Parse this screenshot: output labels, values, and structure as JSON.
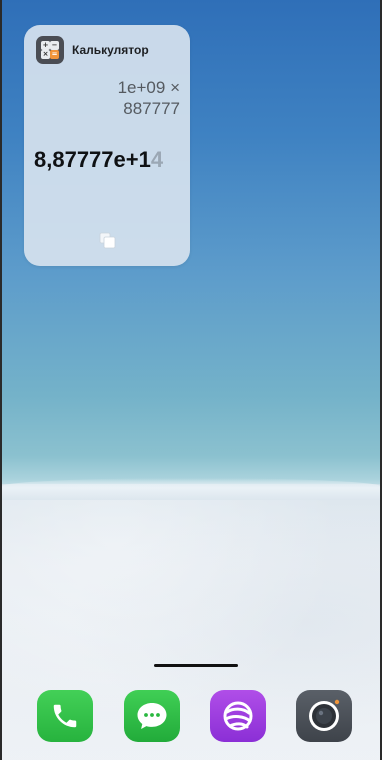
{
  "widget": {
    "app_name": "Калькулятор",
    "expression_line1": "1e+09 ×",
    "expression_line2": "887777",
    "result_main": "8,87777e+1",
    "result_faded": "4"
  },
  "dock": {
    "apps": [
      "phone-icon",
      "messages-icon",
      "browser-icon",
      "camera-icon"
    ]
  },
  "colors": {
    "calc_accent": "#f0953a",
    "phone_green": "#2fbf45",
    "browser_purple": "#9a3ddd",
    "camera_gray": "#4a5058"
  }
}
